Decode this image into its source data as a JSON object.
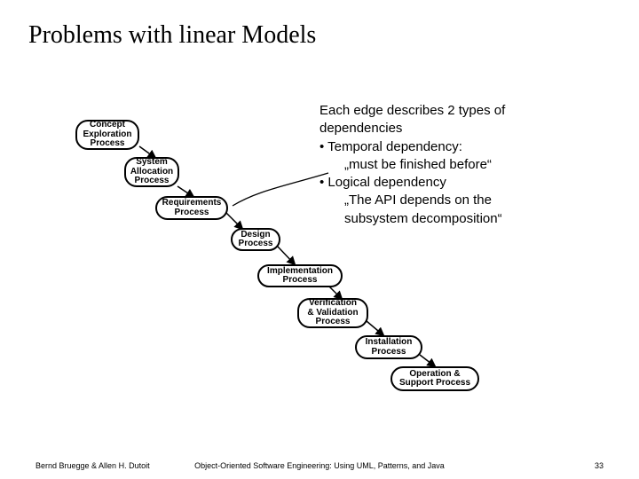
{
  "title": "Problems with linear Models",
  "nodes": {
    "concept": "Concept\nExploration\nProcess",
    "system": "System\nAllocation\nProcess",
    "requirements": "Requirements\nProcess",
    "design": "Design\nProcess",
    "implementation": "Implementation\nProcess",
    "verification": "Verification\n& Validation\nProcess",
    "installation": "Installation\nProcess",
    "operation": "Operation &\nSupport Process"
  },
  "desc": {
    "l1": "Each edge describes 2 types of",
    "l2": "dependencies",
    "l3": "• Temporal dependency:",
    "l4": "„must be finished before“",
    "l5": "• Logical dependency",
    "l6": "„The API depends on the",
    "l7": "subsystem decomposition“"
  },
  "footer": {
    "left": "Bernd Bruegge & Allen H. Dutoit",
    "center": "Object-Oriented Software Engineering: Using UML, Patterns, and Java",
    "right": "33"
  }
}
